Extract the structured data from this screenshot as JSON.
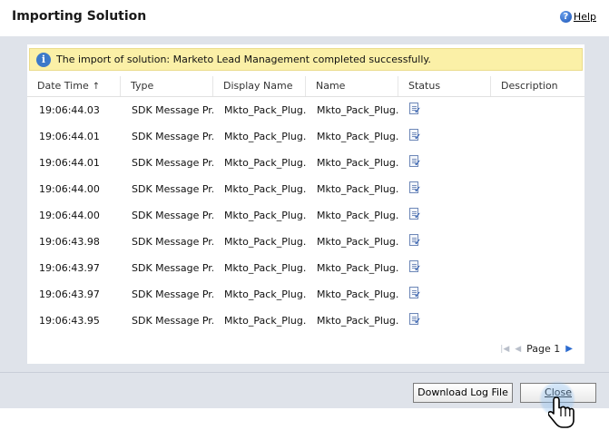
{
  "dialog": {
    "title": "Importing Solution",
    "help_label": "Help",
    "help_icon": "help-icon"
  },
  "notice": {
    "icon": "info-icon",
    "text": "The import of solution: Marketo Lead Management completed successfully."
  },
  "table": {
    "columns": [
      "Date Time",
      "Type",
      "Display Name",
      "Name",
      "Status",
      "Description"
    ],
    "sort_indicator": "↑",
    "rows": [
      {
        "datetime": "19:06:44.03",
        "type": "SDK Message Pr...",
        "display_name": "Mkto_Pack_Plug...",
        "name": "Mkto_Pack_Plug...",
        "status_icon": "success-document-icon",
        "description": ""
      },
      {
        "datetime": "19:06:44.01",
        "type": "SDK Message Pr...",
        "display_name": "Mkto_Pack_Plug...",
        "name": "Mkto_Pack_Plug...",
        "status_icon": "success-document-icon",
        "description": ""
      },
      {
        "datetime": "19:06:44.01",
        "type": "SDK Message Pr...",
        "display_name": "Mkto_Pack_Plug...",
        "name": "Mkto_Pack_Plug...",
        "status_icon": "success-document-icon",
        "description": ""
      },
      {
        "datetime": "19:06:44.00",
        "type": "SDK Message Pr...",
        "display_name": "Mkto_Pack_Plug...",
        "name": "Mkto_Pack_Plug...",
        "status_icon": "success-document-icon",
        "description": ""
      },
      {
        "datetime": "19:06:44.00",
        "type": "SDK Message Pr...",
        "display_name": "Mkto_Pack_Plug...",
        "name": "Mkto_Pack_Plug...",
        "status_icon": "success-document-icon",
        "description": ""
      },
      {
        "datetime": "19:06:43.98",
        "type": "SDK Message Pr...",
        "display_name": "Mkto_Pack_Plug...",
        "name": "Mkto_Pack_Plug...",
        "status_icon": "success-document-icon",
        "description": ""
      },
      {
        "datetime": "19:06:43.97",
        "type": "SDK Message Pr...",
        "display_name": "Mkto_Pack_Plug...",
        "name": "Mkto_Pack_Plug...",
        "status_icon": "success-document-icon",
        "description": ""
      },
      {
        "datetime": "19:06:43.97",
        "type": "SDK Message Pr...",
        "display_name": "Mkto_Pack_Plug...",
        "name": "Mkto_Pack_Plug...",
        "status_icon": "success-document-icon",
        "description": ""
      },
      {
        "datetime": "19:06:43.95",
        "type": "SDK Message Pr...",
        "display_name": "Mkto_Pack_Plug...",
        "name": "Mkto_Pack_Plug...",
        "status_icon": "success-document-icon",
        "description": ""
      }
    ]
  },
  "pager": {
    "label": "Page 1",
    "first_icon": "first-page-icon",
    "prev_icon": "previous-page-icon",
    "next_icon": "next-page-icon"
  },
  "footer": {
    "download_label": "Download Log File",
    "close_label": "Close"
  },
  "colors": {
    "notice_background": "#fbf0a7",
    "panel_background": "#dfe3ea",
    "accent": "#2c6bcf"
  }
}
